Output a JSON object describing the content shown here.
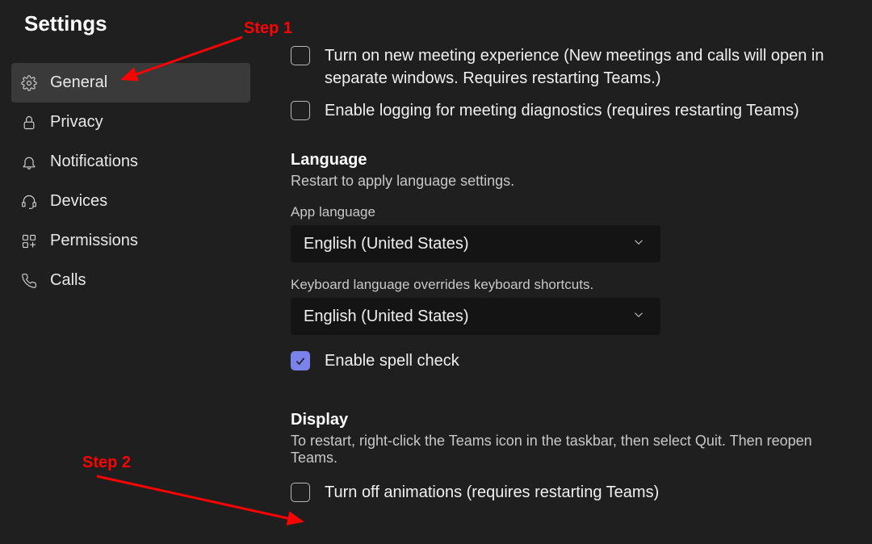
{
  "title": "Settings",
  "sidebar": {
    "items": [
      {
        "label": "General"
      },
      {
        "label": "Privacy"
      },
      {
        "label": "Notifications"
      },
      {
        "label": "Devices"
      },
      {
        "label": "Permissions"
      },
      {
        "label": "Calls"
      }
    ]
  },
  "options": {
    "newMeeting": "Turn on new meeting experience (New meetings and calls will open in separate windows. Requires restarting Teams.)",
    "logging": "Enable logging for meeting diagnostics (requires restarting Teams)"
  },
  "language": {
    "heading": "Language",
    "sub": "Restart to apply language settings.",
    "appLangLabel": "App language",
    "appLangValue": "English (United States)",
    "kbLabel": "Keyboard language overrides keyboard shortcuts.",
    "kbValue": "English (United States)",
    "spellcheck": "Enable spell check"
  },
  "display": {
    "heading": "Display",
    "sub": "To restart, right-click the Teams icon in the taskbar, then select Quit. Then reopen Teams.",
    "turnOffAnim": "Turn off animations (requires restarting Teams)"
  },
  "annotations": {
    "step1": "Step 1",
    "step2": "Step 2"
  }
}
